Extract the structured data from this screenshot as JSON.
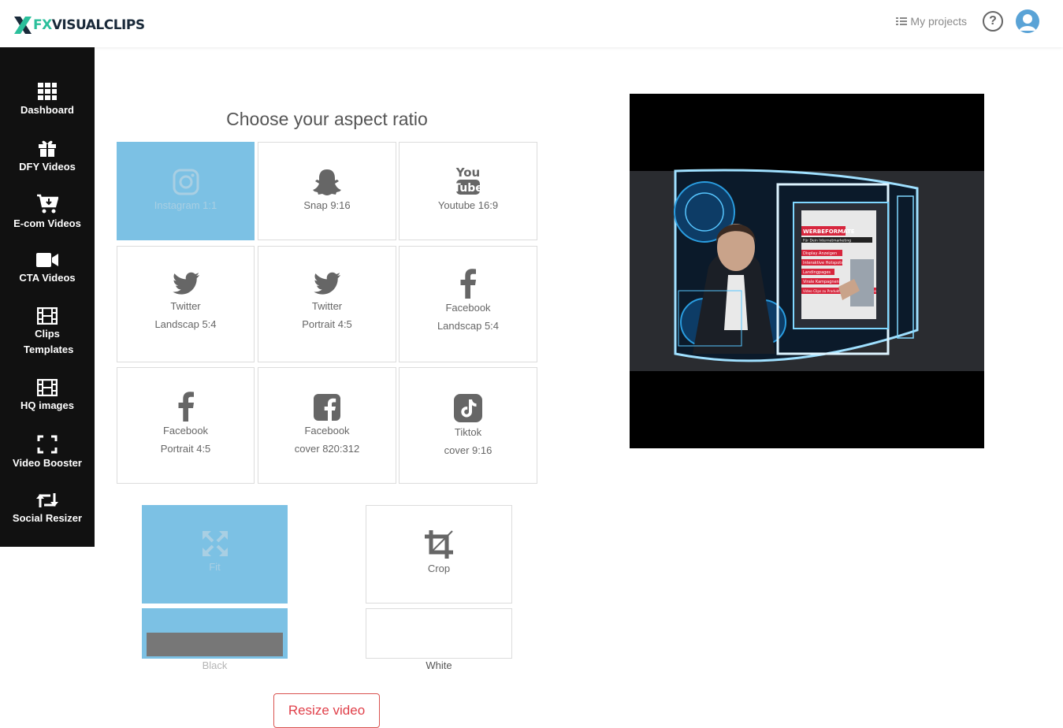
{
  "header": {
    "logo_fx": "FX",
    "logo_rest": "VISUALCLIPS",
    "my_projects": "My projects",
    "help": "?"
  },
  "sidebar": {
    "items": [
      {
        "label": "Dashboard",
        "icon": "grid-icon"
      },
      {
        "label": "DFY Videos",
        "icon": "gift-icon"
      },
      {
        "label": "E-com Videos",
        "icon": "cart-icon"
      },
      {
        "label": "CTA Videos",
        "icon": "video-camera-icon"
      },
      {
        "label": "Clips Templates",
        "icon": "film-icon"
      },
      {
        "label": "HQ images",
        "icon": "film-icon"
      },
      {
        "label": "Video Booster",
        "icon": "expand-icon"
      },
      {
        "label": "Social Resizer",
        "icon": "retweet-icon"
      }
    ]
  },
  "main": {
    "title": "Choose your aspect ratio",
    "ratios": [
      {
        "line1": "Instagram 1:1",
        "line2": "",
        "icon": "instagram-icon",
        "selected": true
      },
      {
        "line1": "Snap 9:16",
        "line2": "",
        "icon": "snapchat-icon",
        "selected": false
      },
      {
        "line1": "Youtube 16:9",
        "line2": "",
        "icon": "youtube-icon",
        "selected": false
      },
      {
        "line1": "Twitter",
        "line2": "Landscap 5:4",
        "icon": "twitter-icon",
        "selected": false
      },
      {
        "line1": "Twitter",
        "line2": "Portrait 4:5",
        "icon": "twitter-icon",
        "selected": false
      },
      {
        "line1": "Facebook",
        "line2": "Landscap 5:4",
        "icon": "facebook-icon",
        "selected": false
      },
      {
        "line1": "Facebook",
        "line2": "Portrait 4:5",
        "icon": "facebook-icon",
        "selected": false
      },
      {
        "line1": "Facebook",
        "line2": "cover 820:312",
        "icon": "facebook-square-icon",
        "selected": false
      },
      {
        "line1": "Tiktok",
        "line2": "cover 9:16",
        "icon": "tiktok-icon",
        "selected": false
      }
    ],
    "modes": {
      "fit": "Fit",
      "crop": "Crop"
    },
    "backgrounds": {
      "black": "Black",
      "white": "White"
    },
    "resize_button": "Resize video"
  },
  "preview": {
    "overlay_title": "WERBEFORMATE",
    "overlay_subtitle": "Für Dein Internetmarketing",
    "overlay_items": [
      "Display Anzeigen",
      "Interaktive Hotspots",
      "Landingpages",
      "Virale Kampagnen",
      "Video Clips zu Produkten & Dienstleistungen"
    ]
  },
  "colors": {
    "selected_bg": "#7cc1e4",
    "accent": "#e0404a",
    "sidebar_bg": "#111111",
    "brand_green": "#2bbf9b"
  }
}
